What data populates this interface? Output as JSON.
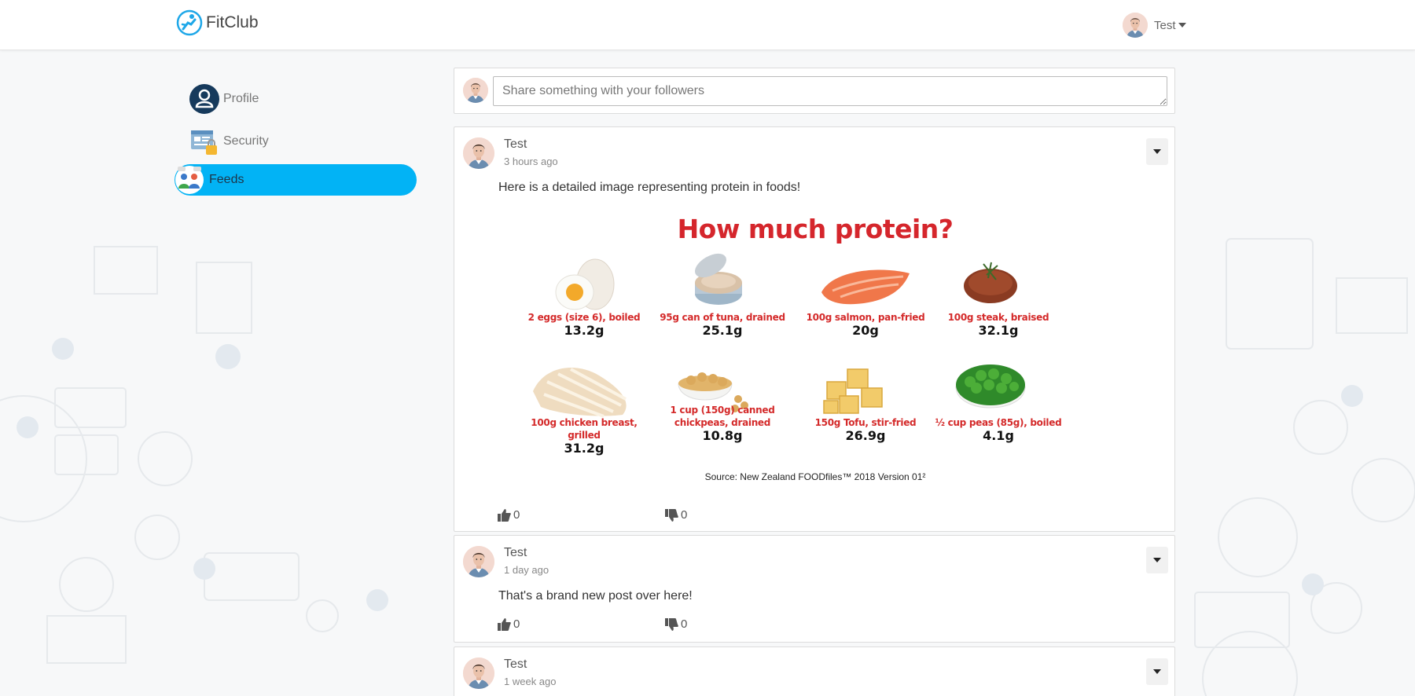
{
  "app": {
    "brand": "FitClub",
    "user": "Test"
  },
  "sidebar": {
    "items": [
      {
        "label": "Profile",
        "icon": "user-circle-icon",
        "active": false
      },
      {
        "label": "Security",
        "icon": "security-lock-icon",
        "active": false
      },
      {
        "label": "Feeds",
        "icon": "feeds-people-icon",
        "active": true
      }
    ]
  },
  "composer": {
    "placeholder": "Share something with your followers"
  },
  "posts": [
    {
      "author": "Test",
      "time": "3 hours ago",
      "text": "Here is a detailed image representing protein in foods!",
      "likes": "0",
      "dislikes": "0",
      "image": {
        "title": "How much protein?",
        "items": [
          {
            "name": "2 eggs (size 6), boiled",
            "value": "13.2g",
            "icon": "eggs-icon"
          },
          {
            "name": "95g can of tuna, drained",
            "value": "25.1g",
            "icon": "tuna-can-icon"
          },
          {
            "name": "100g salmon, pan-fried",
            "value": "20g",
            "icon": "salmon-icon"
          },
          {
            "name": "100g steak, braised",
            "value": "32.1g",
            "icon": "steak-icon"
          },
          {
            "name": "100g chicken breast, grilled",
            "value": "31.2g",
            "icon": "chicken-breast-icon"
          },
          {
            "name": "1 cup (150g) canned chickpeas, drained",
            "value": "10.8g",
            "icon": "chickpeas-icon"
          },
          {
            "name": "150g Tofu, stir-fried",
            "value": "26.9g",
            "icon": "tofu-icon"
          },
          {
            "name": "½ cup peas (85g), boiled",
            "value": "4.1g",
            "icon": "peas-icon"
          }
        ],
        "source": "Source: New Zealand FOODfiles™ 2018 Version 01²"
      }
    },
    {
      "author": "Test",
      "time": "1 day ago",
      "text": "That's a brand new post over here!",
      "likes": "0",
      "dislikes": "0"
    },
    {
      "author": "Test",
      "time": "1 week ago"
    }
  ],
  "colors": {
    "accent": "#02b3f5",
    "title_red": "#d5262c"
  }
}
